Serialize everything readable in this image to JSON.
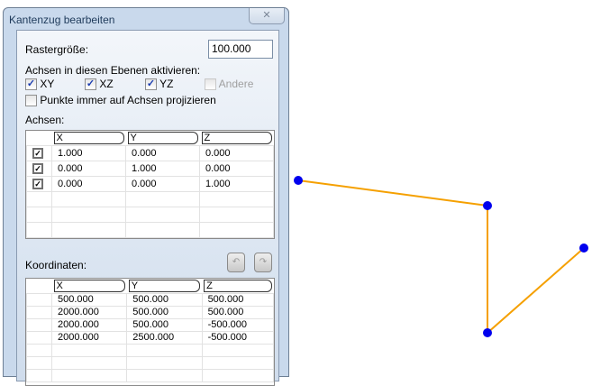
{
  "dialog": {
    "title": "Kantenzug bearbeiten",
    "close_icon": "close-icon",
    "grid_size_label": "Rastergröße:",
    "grid_size_value": "100.000",
    "axes_planes_label": "Achsen in diesen Ebenen aktivieren:",
    "planes": [
      {
        "label": "XY",
        "checked": true,
        "enabled": true
      },
      {
        "label": "XZ",
        "checked": true,
        "enabled": true
      },
      {
        "label": "YZ",
        "checked": true,
        "enabled": true
      },
      {
        "label": "Andere",
        "checked": false,
        "enabled": false
      }
    ],
    "project_label": "Punkte immer auf Achsen projizieren",
    "project_checked": false,
    "axes_label": "Achsen:",
    "axes_table": {
      "headers": [
        "X",
        "Y",
        "Z"
      ],
      "rows": [
        {
          "checked": true,
          "values": [
            "1.000",
            "0.000",
            "0.000"
          ]
        },
        {
          "checked": true,
          "values": [
            "0.000",
            "1.000",
            "0.000"
          ]
        },
        {
          "checked": true,
          "values": [
            "0.000",
            "0.000",
            "1.000"
          ]
        }
      ]
    },
    "coords_label": "Koordinaten:",
    "undo_icon": "undo-icon",
    "redo_icon": "redo-icon",
    "coords_table": {
      "headers": [
        "X",
        "Y",
        "Z"
      ],
      "rows": [
        [
          "500.000",
          "500.000",
          "500.000"
        ],
        [
          "2000.000",
          "500.000",
          "500.000"
        ],
        [
          "2000.000",
          "500.000",
          "-500.000"
        ],
        [
          "2000.000",
          "2500.000",
          "-500.000"
        ]
      ]
    }
  },
  "colors": {
    "polyline": "#f5a000",
    "vertex": "#0000ee"
  }
}
